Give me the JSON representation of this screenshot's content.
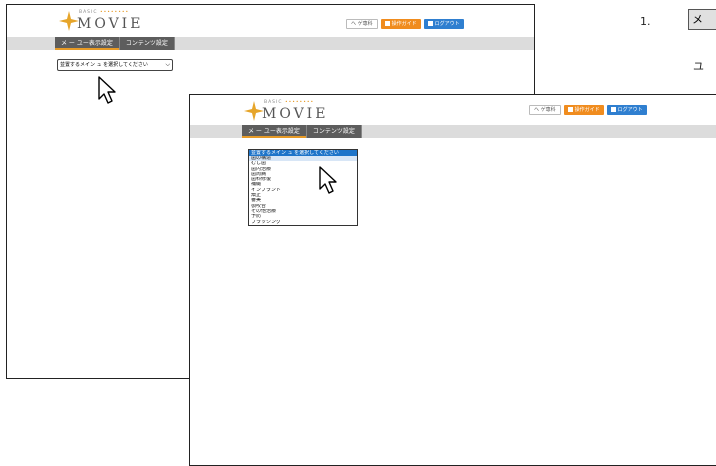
{
  "app": {
    "logo_small": "BASIC",
    "logo_small_accent": "••••••••",
    "logo_word": "MOVIE"
  },
  "header_buttons": {
    "help": "ヘ ゲ専科",
    "guide": "操作ガイド",
    "logout": "ログアウト"
  },
  "nav": {
    "tabs": [
      "メ ー ユー表示設定",
      "コンテンツ設定"
    ]
  },
  "screen1": {
    "select_value": "並置するメイン ュ  を選択してください"
  },
  "screen2": {
    "listbox_options": [
      "並置するメイン ュ  を選択してください",
      "歯の構造",
      "むし歯",
      "歯内治療",
      "歯周病",
      "歯科修復",
      "補綴",
      "インプラント",
      "矯正",
      "審美",
      "顎咬合",
      "その他治療",
      "予防",
      "ブラッシング"
    ],
    "selected_index": 0,
    "hover_index": 1
  },
  "instructions": {
    "step_number": "1.",
    "step_box": "メ",
    "step_text": "ユ"
  },
  "colors": {
    "tab_bg": "#5d5d5d",
    "tab_active_accent": "#e69a27",
    "guide": "#f08c1e",
    "logout": "#2f7fd0",
    "selected": "#1e74c9"
  }
}
